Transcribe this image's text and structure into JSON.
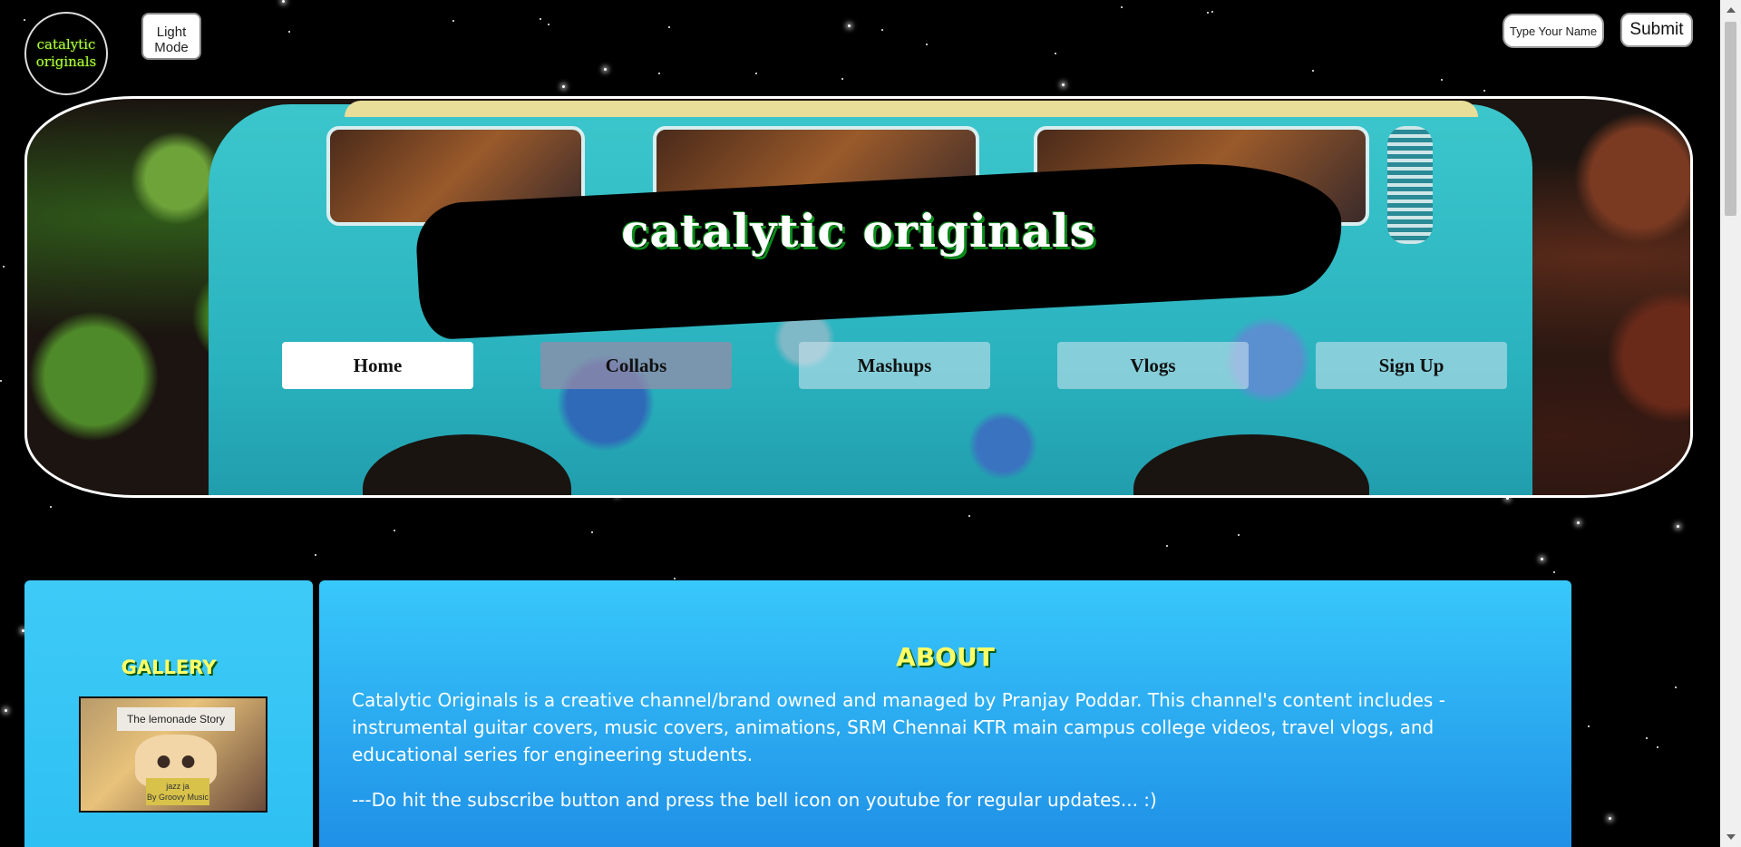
{
  "header": {
    "logo_text_line1": "catalytic",
    "logo_text_line2": "originals",
    "mode_toggle_line1": "Light",
    "mode_toggle_line2": "Mode",
    "name_placeholder": "Type Your Name",
    "submit_label": "Submit"
  },
  "hero": {
    "title": "catalytic originals",
    "nav": [
      {
        "label": "Home",
        "active": true
      },
      {
        "label": "Collabs",
        "active": false
      },
      {
        "label": "Mashups",
        "active": false
      },
      {
        "label": "Vlogs",
        "active": false
      },
      {
        "label": "Sign Up",
        "active": false
      }
    ]
  },
  "gallery": {
    "heading": "GALLERY",
    "thumb_title": "The lemonade Story",
    "thumb_tag_line1": "jazz ja",
    "thumb_tag_line2": "By Groovy Music"
  },
  "about": {
    "heading": "ABOUT",
    "paragraph1": "Catalytic Originals is a creative channel/brand owned and managed by Pranjay Poddar. This channel's content includes - instrumental guitar covers, music covers, animations, SRM Chennai KTR main campus college videos, travel vlogs, and educational series for engineering students.",
    "paragraph2": "---Do hit the subscribe button and press the bell icon on youtube for regular updates... :)"
  },
  "colors": {
    "background": "#000000",
    "panel_blue": "#38c8fb",
    "heading_yellow": "#ffff66",
    "logo_green": "#b6ff3a"
  }
}
